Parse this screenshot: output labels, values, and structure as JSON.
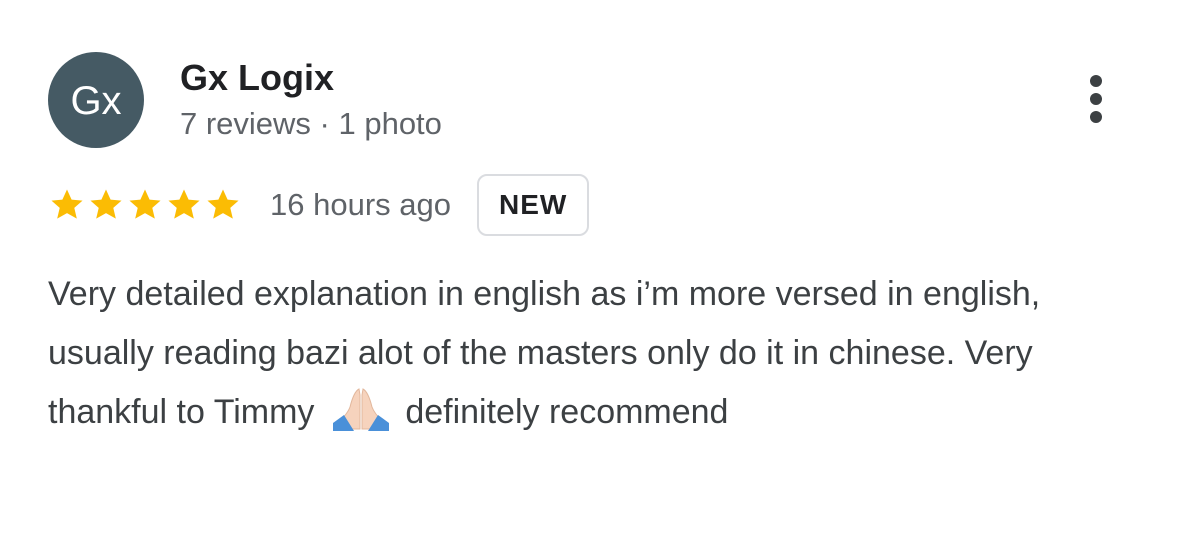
{
  "reviewer": {
    "initials": "Gx",
    "name": "Gx Logix",
    "meta": "7 reviews · 1 photo",
    "avatar_color": "#455a64"
  },
  "menu": {
    "icon": "more-vert-icon"
  },
  "rating": {
    "stars": 5,
    "max_stars": 5,
    "star_color": "#fbbc04",
    "time": "16 hours ago",
    "badge": "NEW"
  },
  "review": {
    "text_before_emoji": "Very detailed explanation in english as i’m more versed in english, usually reading bazi alot of the masters only do it in chinese. Very thankful to Timmy",
    "emoji": "folded-hands-emoji",
    "text_after_emoji": "definitely recommend"
  }
}
